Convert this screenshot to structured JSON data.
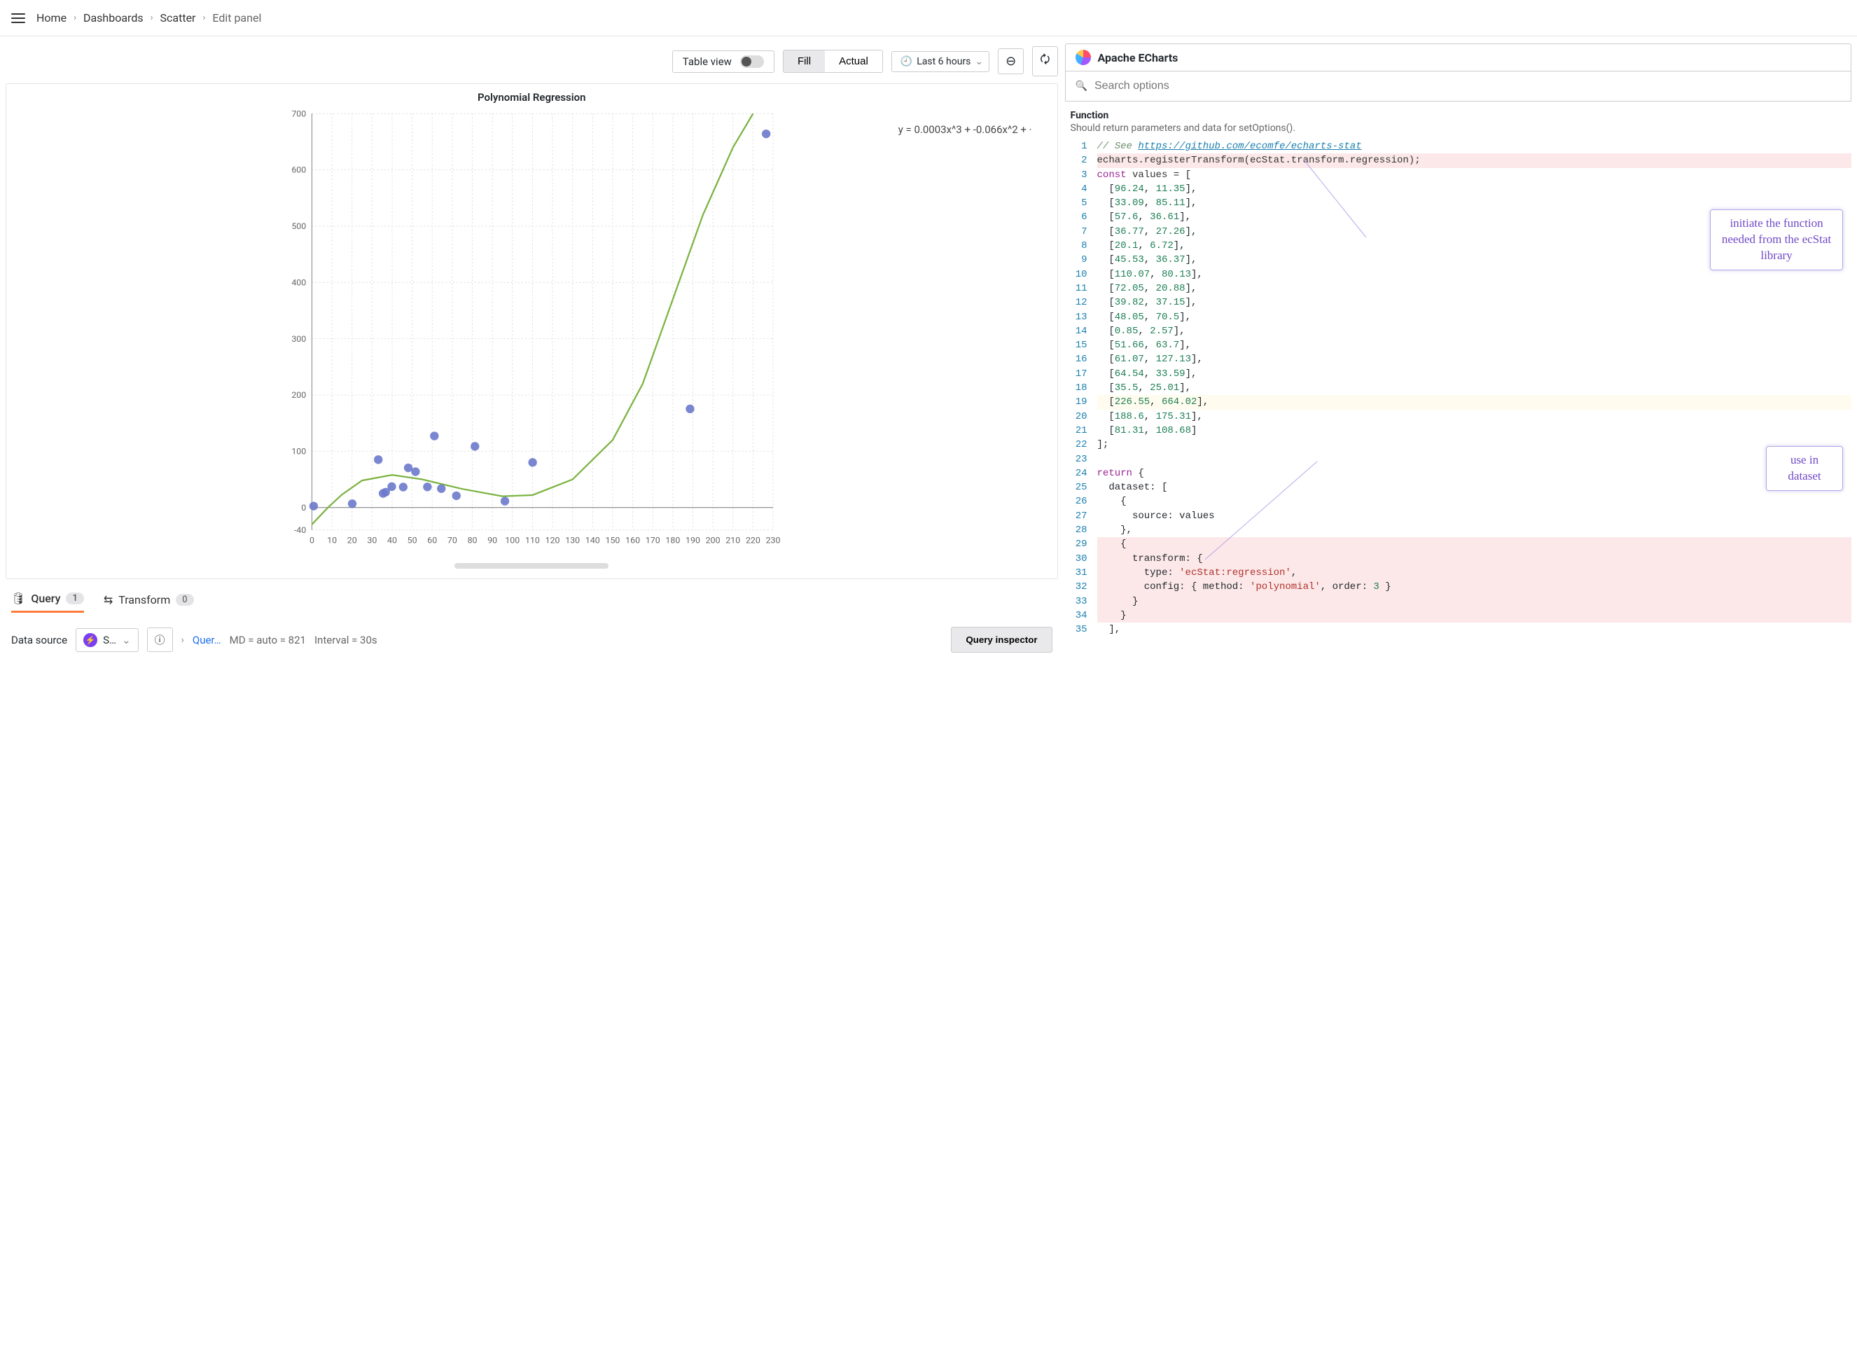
{
  "breadcrumb": [
    "Home",
    "Dashboards",
    "Scatter",
    "Edit panel"
  ],
  "toolbar": {
    "table_view": "Table view",
    "fill_label": "Fill",
    "actual_label": "Actual",
    "time_range": "Last 6 hours"
  },
  "panel_title": "Apache ECharts",
  "search_placeholder": "Search options",
  "func_header": "Function",
  "func_sub": "Should return parameters and data for setOptions().",
  "chart_data": {
    "type": "scatter",
    "title": "Polynomial Regression",
    "equation": "y = 0.0003x^3 + -0.066x^2 + ·",
    "xlim": [
      0,
      230
    ],
    "ylim": [
      -40,
      700
    ],
    "xticks": [
      0,
      10,
      20,
      30,
      40,
      50,
      60,
      70,
      80,
      90,
      100,
      110,
      120,
      130,
      140,
      150,
      160,
      170,
      180,
      190,
      200,
      210,
      220,
      230
    ],
    "yticks": [
      -40,
      0,
      100,
      200,
      300,
      400,
      500,
      600,
      700
    ],
    "points": [
      [
        96.24,
        11.35
      ],
      [
        33.09,
        85.11
      ],
      [
        57.6,
        36.61
      ],
      [
        36.77,
        27.26
      ],
      [
        20.1,
        6.72
      ],
      [
        45.53,
        36.37
      ],
      [
        110.07,
        80.13
      ],
      [
        72.05,
        20.88
      ],
      [
        39.82,
        37.15
      ],
      [
        48.05,
        70.5
      ],
      [
        0.85,
        2.57
      ],
      [
        51.66,
        63.7
      ],
      [
        61.07,
        127.13
      ],
      [
        64.54,
        33.59
      ],
      [
        35.5,
        25.01
      ],
      [
        226.55,
        664.02
      ],
      [
        188.6,
        175.31
      ],
      [
        81.31,
        108.68
      ]
    ],
    "regression_curve": [
      [
        0,
        -30
      ],
      [
        8,
        0
      ],
      [
        15,
        23
      ],
      [
        25,
        48
      ],
      [
        40,
        58
      ],
      [
        55,
        50
      ],
      [
        75,
        33
      ],
      [
        95,
        20
      ],
      [
        110,
        22
      ],
      [
        130,
        50
      ],
      [
        150,
        120
      ],
      [
        165,
        220
      ],
      [
        180,
        370
      ],
      [
        195,
        520
      ],
      [
        210,
        640
      ],
      [
        220,
        700
      ]
    ]
  },
  "callouts": {
    "top": "initiate the function needed from the ecStat library",
    "bot": "use in dataset"
  },
  "code_lines": [
    {
      "n": 1,
      "html": "<span class='tok-comment'>// See <span class='tok-link'>https://github.com/ecomfe/echarts-stat</span></span>"
    },
    {
      "n": 2,
      "html": "<span class='tok-fn'>echarts.registerTransform(ecStat.transform.regression);</span>",
      "hl": "hl-pink"
    },
    {
      "n": 3,
      "html": "<span class='tok-keyword'>const</span> <span class='tok-fn'>values</span> = ["
    },
    {
      "n": 4,
      "html": "  [<span class='tok-num'>96.24</span>, <span class='tok-num'>11.35</span>],"
    },
    {
      "n": 5,
      "html": "  [<span class='tok-num'>33.09</span>, <span class='tok-num'>85.11</span>],"
    },
    {
      "n": 6,
      "html": "  [<span class='tok-num'>57.6</span>, <span class='tok-num'>36.61</span>],"
    },
    {
      "n": 7,
      "html": "  [<span class='tok-num'>36.77</span>, <span class='tok-num'>27.26</span>],"
    },
    {
      "n": 8,
      "html": "  [<span class='tok-num'>20.1</span>, <span class='tok-num'>6.72</span>],"
    },
    {
      "n": 9,
      "html": "  [<span class='tok-num'>45.53</span>, <span class='tok-num'>36.37</span>],"
    },
    {
      "n": 10,
      "html": "  [<span class='tok-num'>110.07</span>, <span class='tok-num'>80.13</span>],"
    },
    {
      "n": 11,
      "html": "  [<span class='tok-num'>72.05</span>, <span class='tok-num'>20.88</span>],"
    },
    {
      "n": 12,
      "html": "  [<span class='tok-num'>39.82</span>, <span class='tok-num'>37.15</span>],"
    },
    {
      "n": 13,
      "html": "  [<span class='tok-num'>48.05</span>, <span class='tok-num'>70.5</span>],"
    },
    {
      "n": 14,
      "html": "  [<span class='tok-num'>0.85</span>, <span class='tok-num'>2.57</span>],"
    },
    {
      "n": 15,
      "html": "  [<span class='tok-num'>51.66</span>, <span class='tok-num'>63.7</span>],"
    },
    {
      "n": 16,
      "html": "  [<span class='tok-num'>61.07</span>, <span class='tok-num'>127.13</span>],"
    },
    {
      "n": 17,
      "html": "  [<span class='tok-num'>64.54</span>, <span class='tok-num'>33.59</span>],"
    },
    {
      "n": 18,
      "html": "  [<span class='tok-num'>35.5</span>, <span class='tok-num'>25.01</span>],"
    },
    {
      "n": 19,
      "html": "  [<span class='tok-num'>226.55</span>, <span class='tok-num'>664.02</span>],",
      "hl": "hl-yellow"
    },
    {
      "n": 20,
      "html": "  [<span class='tok-num'>188.6</span>, <span class='tok-num'>175.31</span>],"
    },
    {
      "n": 21,
      "html": "  [<span class='tok-num'>81.31</span>, <span class='tok-num'>108.68</span>]"
    },
    {
      "n": 22,
      "html": "];"
    },
    {
      "n": 23,
      "html": ""
    },
    {
      "n": 24,
      "html": "<span class='tok-keyword'>return</span> {"
    },
    {
      "n": 25,
      "html": "  dataset: ["
    },
    {
      "n": 26,
      "html": "    {"
    },
    {
      "n": 27,
      "html": "      source: values"
    },
    {
      "n": 28,
      "html": "    },"
    },
    {
      "n": 29,
      "html": "    {",
      "hl": "hl-pink"
    },
    {
      "n": 30,
      "html": "      transform: {",
      "hl": "hl-pink"
    },
    {
      "n": 31,
      "html": "        type: <span class='tok-str'>'ecStat:regression'</span>,",
      "hl": "hl-pink"
    },
    {
      "n": 32,
      "html": "        config: { method: <span class='tok-str'>'polynomial'</span>, order: <span class='tok-num'>3</span> }",
      "hl": "hl-pink"
    },
    {
      "n": 33,
      "html": "      }",
      "hl": "hl-pink"
    },
    {
      "n": 34,
      "html": "    }",
      "hl": "hl-pink"
    },
    {
      "n": 35,
      "html": "  ],"
    }
  ],
  "bottom": {
    "query_tab": "Query",
    "query_count": "1",
    "transform_tab": "Transform",
    "transform_count": "0",
    "ds_label": "Data source",
    "ds_value": "S…",
    "query_link": "Quer…",
    "md": "MD = auto = 821",
    "interval": "Interval = 30s",
    "inspector": "Query inspector"
  }
}
